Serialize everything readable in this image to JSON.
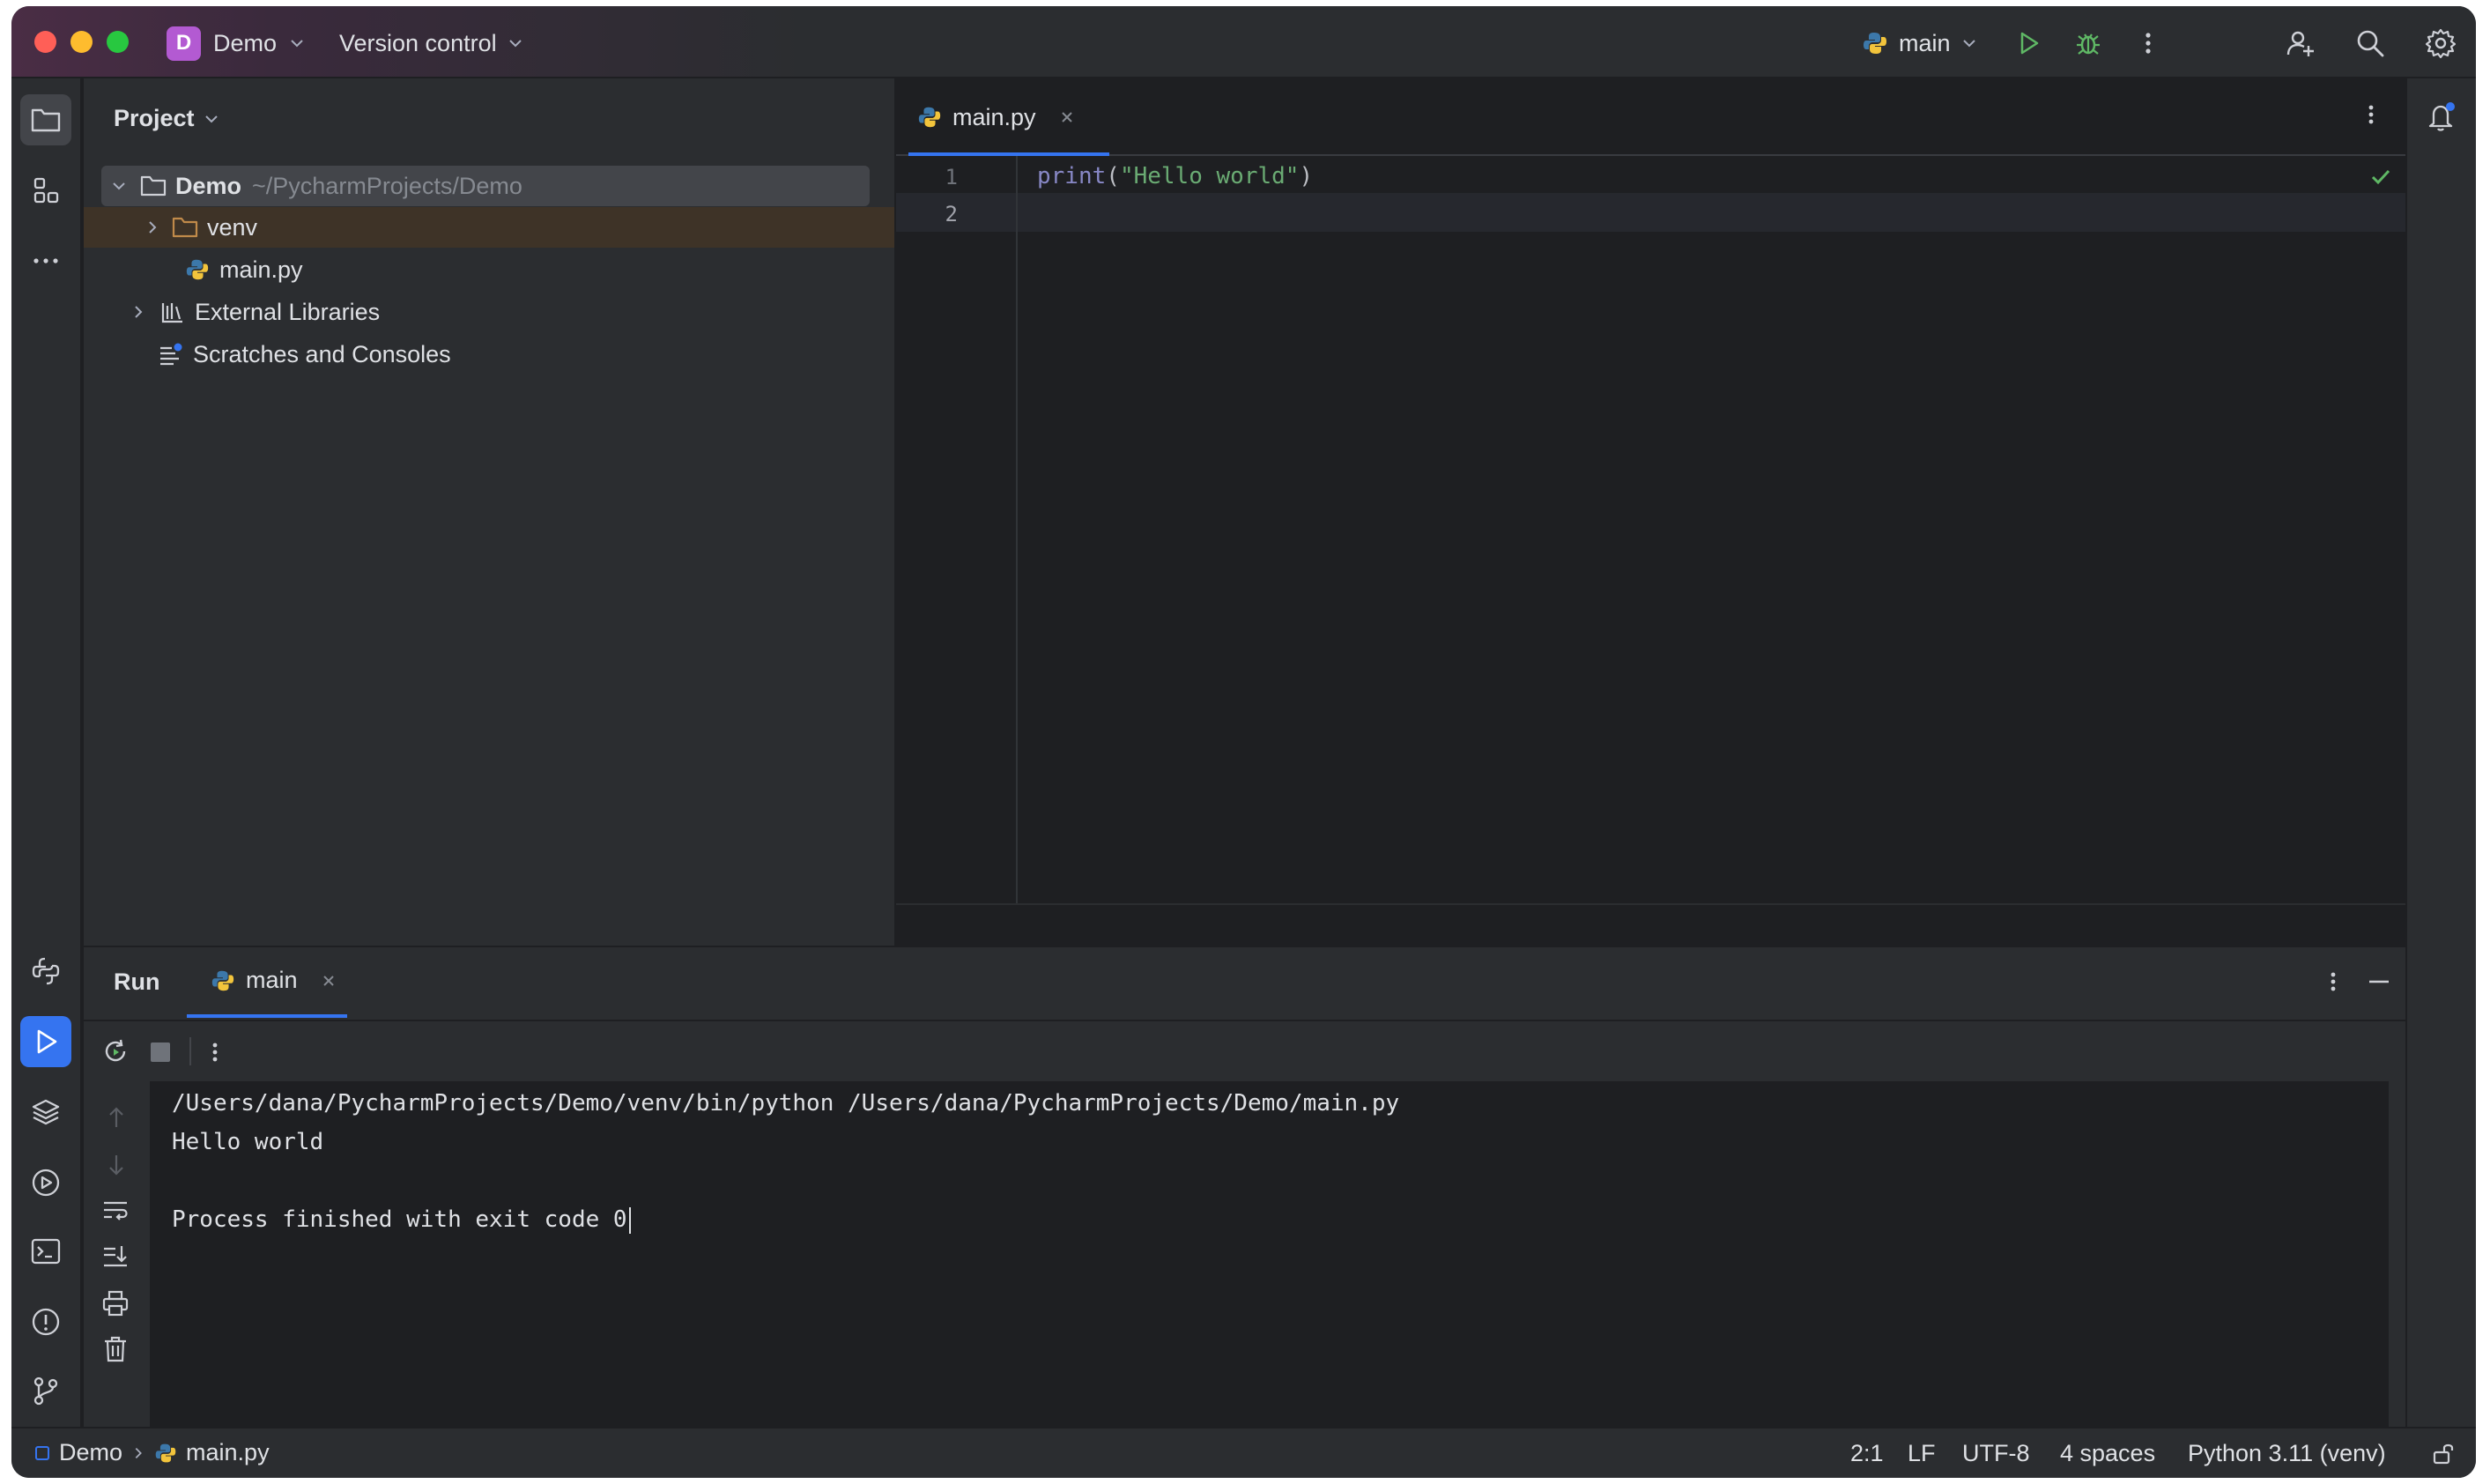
{
  "titlebar": {
    "project_badge": "D",
    "project_name": "Demo",
    "version_control": "Version control",
    "run_config": "main"
  },
  "project_panel": {
    "title": "Project",
    "tree": {
      "root_name": "Demo",
      "root_path": "~/PycharmProjects/Demo",
      "venv": "venv",
      "main_file": "main.py",
      "external_libraries": "External Libraries",
      "scratches": "Scratches and Consoles"
    }
  },
  "editor": {
    "tab_label": "main.py",
    "lines": [
      {
        "number": "1",
        "fn": "print",
        "open": "(",
        "string": "\"Hello world\"",
        "close": ")"
      },
      {
        "number": "2"
      }
    ]
  },
  "run_panel": {
    "title": "Run",
    "tab_label": "main",
    "console": [
      "/Users/dana/PycharmProjects/Demo/venv/bin/python /Users/dana/PycharmProjects/Demo/main.py",
      "Hello world",
      "",
      "Process finished with exit code 0"
    ]
  },
  "statusbar": {
    "breadcrumb_project": "Demo",
    "breadcrumb_file": "main.py",
    "caret_position": "2:1",
    "line_separator": "LF",
    "encoding": "UTF-8",
    "indent": "4 spaces",
    "interpreter": "Python 3.11 (venv)"
  },
  "colors": {
    "accent": "#3574f0",
    "project_badge": "#b35ad2",
    "run_green": "#5fb865",
    "string_green": "#6aab73"
  }
}
